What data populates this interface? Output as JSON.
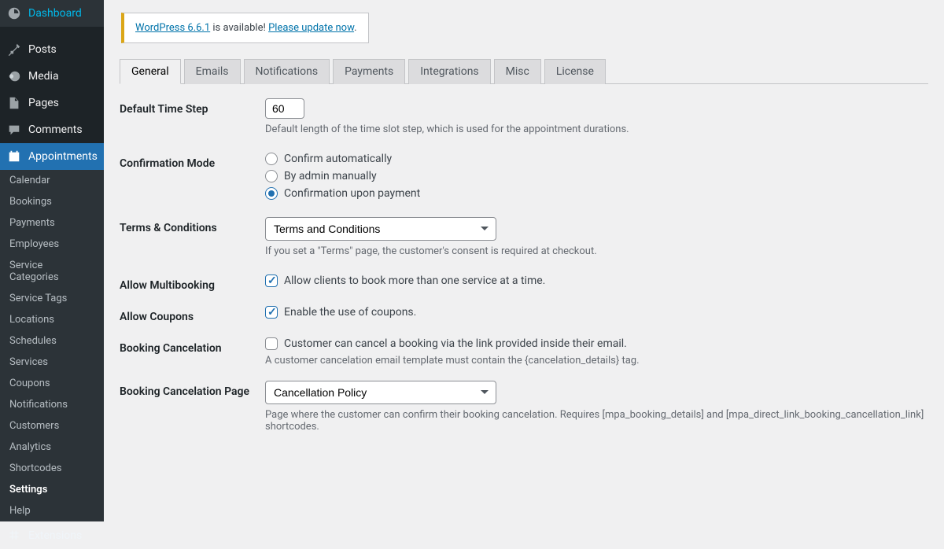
{
  "sidebar": {
    "top": [
      {
        "icon": "dashboard",
        "label": "Dashboard"
      },
      {
        "icon": "pin",
        "label": "Posts"
      },
      {
        "icon": "media",
        "label": "Media"
      },
      {
        "icon": "page",
        "label": "Pages"
      },
      {
        "icon": "comments",
        "label": "Comments"
      },
      {
        "icon": "calendar",
        "label": "Appointments"
      }
    ],
    "sub": [
      "Calendar",
      "Bookings",
      "Payments",
      "Employees",
      "Service Categories",
      "Service Tags",
      "Locations",
      "Schedules",
      "Services",
      "Coupons",
      "Notifications",
      "Customers",
      "Analytics",
      "Shortcodes",
      "Settings",
      "Help"
    ],
    "collapse_icon": "plugin",
    "collapse_label": "Extensions"
  },
  "notice": {
    "link1": "WordPress 6.6.1",
    "mid": " is available! ",
    "link2": "Please update now",
    "tail": "."
  },
  "tabs": [
    "General",
    "Emails",
    "Notifications",
    "Payments",
    "Integrations",
    "Misc",
    "License"
  ],
  "fields": {
    "timestep": {
      "label": "Default Time Step",
      "value": "60",
      "desc": "Default length of the time slot step, which is used for the appointment durations."
    },
    "confirm": {
      "label": "Confirmation Mode",
      "opts": [
        "Confirm automatically",
        "By admin manually",
        "Confirmation upon payment"
      ]
    },
    "terms": {
      "label": "Terms & Conditions",
      "value": "Terms and Conditions",
      "desc": "If you set a \"Terms\" page, the customer's consent is required at checkout."
    },
    "multi": {
      "label": "Allow Multibooking",
      "opt": "Allow clients to book more than one service at a time."
    },
    "coupons": {
      "label": "Allow Coupons",
      "opt": "Enable the use of coupons."
    },
    "cancel": {
      "label": "Booking Cancelation",
      "opt": "Customer can cancel a booking via the link provided inside their email.",
      "desc": "A customer cancelation email template must contain the {cancelation_details} tag."
    },
    "cancelpage": {
      "label": "Booking Cancelation Page",
      "value": "Cancellation Policy",
      "desc": "Page where the customer can confirm their booking cancelation. Requires [mpa_booking_details] and [mpa_direct_link_booking_cancellation_link] shortcodes."
    }
  }
}
